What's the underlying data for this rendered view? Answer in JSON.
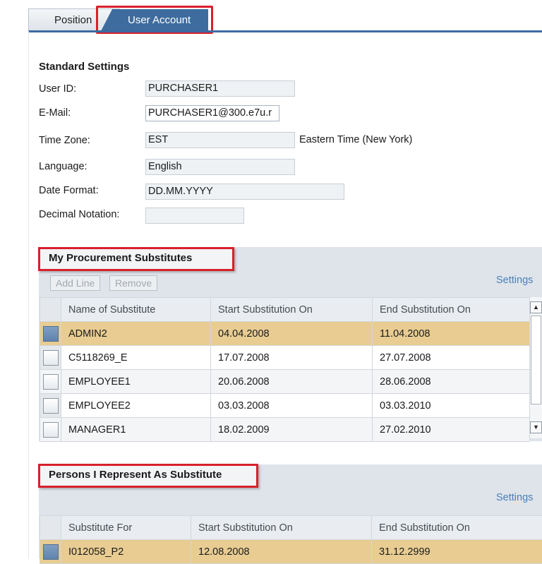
{
  "tabs": [
    {
      "label": "Position"
    },
    {
      "label": "User Account"
    }
  ],
  "standard_settings": {
    "heading": "Standard Settings",
    "user_id": {
      "label": "User ID:",
      "value": "PURCHASER1"
    },
    "email": {
      "label": "E-Mail:",
      "value": "PURCHASER1@300.e7u.r"
    },
    "time_zone": {
      "label": "Time Zone:",
      "value": "EST",
      "description": "Eastern Time (New York)"
    },
    "language": {
      "label": "Language:",
      "value": "English"
    },
    "date_format": {
      "label": "Date Format:",
      "value": "DD.MM.YYYY"
    },
    "decimal_notation": {
      "label": "Decimal Notation:",
      "value": ""
    }
  },
  "procurement_substitutes": {
    "title": "My Procurement Substitutes",
    "add_line": "Add Line",
    "remove": "Remove",
    "settings": "Settings",
    "columns": [
      "Name of Substitute",
      "Start Substitution On",
      "End Substitution On"
    ],
    "rows": [
      {
        "name": "ADMIN2",
        "start": "04.04.2008",
        "end": "11.04.2008",
        "selected": true
      },
      {
        "name": "C5118269_E",
        "start": "17.07.2008",
        "end": "27.07.2008"
      },
      {
        "name": "EMPLOYEE1",
        "start": "20.06.2008",
        "end": "28.06.2008"
      },
      {
        "name": "EMPLOYEE2",
        "start": "03.03.2008",
        "end": "03.03.2010"
      },
      {
        "name": "MANAGER1",
        "start": "18.02.2009",
        "end": "27.02.2010"
      }
    ]
  },
  "represent_as_substitute": {
    "title": "Persons I Represent As Substitute",
    "settings": "Settings",
    "columns": [
      "Substitute For",
      "Start Substitution On",
      "End Substitution On"
    ],
    "rows": [
      {
        "name": "I012058_P2",
        "start": "12.08.2008",
        "end": "31.12.2999",
        "selected": true
      }
    ]
  },
  "colors": {
    "accent": "#3e6c9e",
    "highlight_box": "#d8202b",
    "selected_row": "#e8cc92",
    "link": "#4a7fb6"
  }
}
